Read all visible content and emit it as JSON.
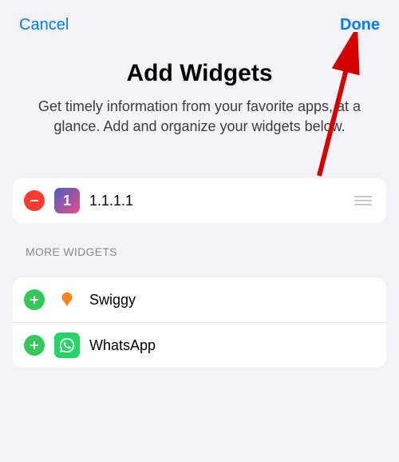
{
  "header": {
    "cancel": "Cancel",
    "done": "Done"
  },
  "title": "Add Widgets",
  "subtitle": "Get timely information from your favorite apps, at a glance. Add and organize your widgets below.",
  "active_widgets": [
    {
      "name": "1.1.1.1",
      "icon": "one"
    }
  ],
  "more_section_label": "MORE WIDGETS",
  "more_widgets": [
    {
      "name": "Swiggy",
      "icon": "swiggy"
    },
    {
      "name": "WhatsApp",
      "icon": "whatsapp"
    }
  ],
  "colors": {
    "accent": "#007aff",
    "remove": "#ff3b30",
    "add": "#34c759"
  }
}
